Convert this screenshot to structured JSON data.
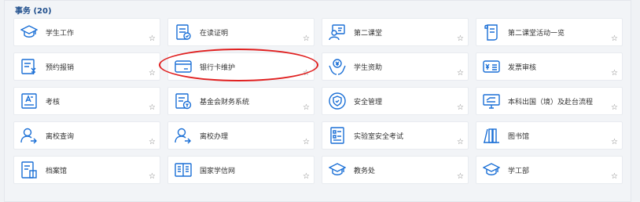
{
  "section": {
    "title": "事务 (20)"
  },
  "star_glyph": "☆",
  "accent_color": "#1a6fd6",
  "highlight_color": "#e02020",
  "cards": [
    {
      "label": "学生工作",
      "icon": "graduation-cap-icon"
    },
    {
      "label": "在读证明",
      "icon": "certificate-document-icon"
    },
    {
      "label": "第二课堂",
      "icon": "presenter-board-icon"
    },
    {
      "label": "第二课堂活动一览",
      "icon": "scroll-document-icon"
    },
    {
      "label": "预约报销",
      "icon": "reimbursement-document-icon"
    },
    {
      "label": "银行卡维护",
      "icon": "bank-card-icon"
    },
    {
      "label": "学生资助",
      "icon": "hands-coin-icon"
    },
    {
      "label": "发票审核",
      "icon": "invoice-icon"
    },
    {
      "label": "考核",
      "icon": "assessment-icon"
    },
    {
      "label": "基金会财务系统",
      "icon": "foundation-finance-icon"
    },
    {
      "label": "安全管理",
      "icon": "shield-icon"
    },
    {
      "label": "本科出国（境）及赴台流程",
      "icon": "travel-monitor-icon"
    },
    {
      "label": "离校查询",
      "icon": "user-arrow-icon"
    },
    {
      "label": "离校办理",
      "icon": "user-arrow-icon"
    },
    {
      "label": "实验室安全考试",
      "icon": "lab-exam-icon"
    },
    {
      "label": "图书馆",
      "icon": "library-books-icon"
    },
    {
      "label": "档案馆",
      "icon": "archive-icon"
    },
    {
      "label": "国家学信网",
      "icon": "open-book-icon"
    },
    {
      "label": "教务处",
      "icon": "graduation-cap-icon"
    },
    {
      "label": "学工部",
      "icon": "graduation-cap-icon"
    }
  ]
}
